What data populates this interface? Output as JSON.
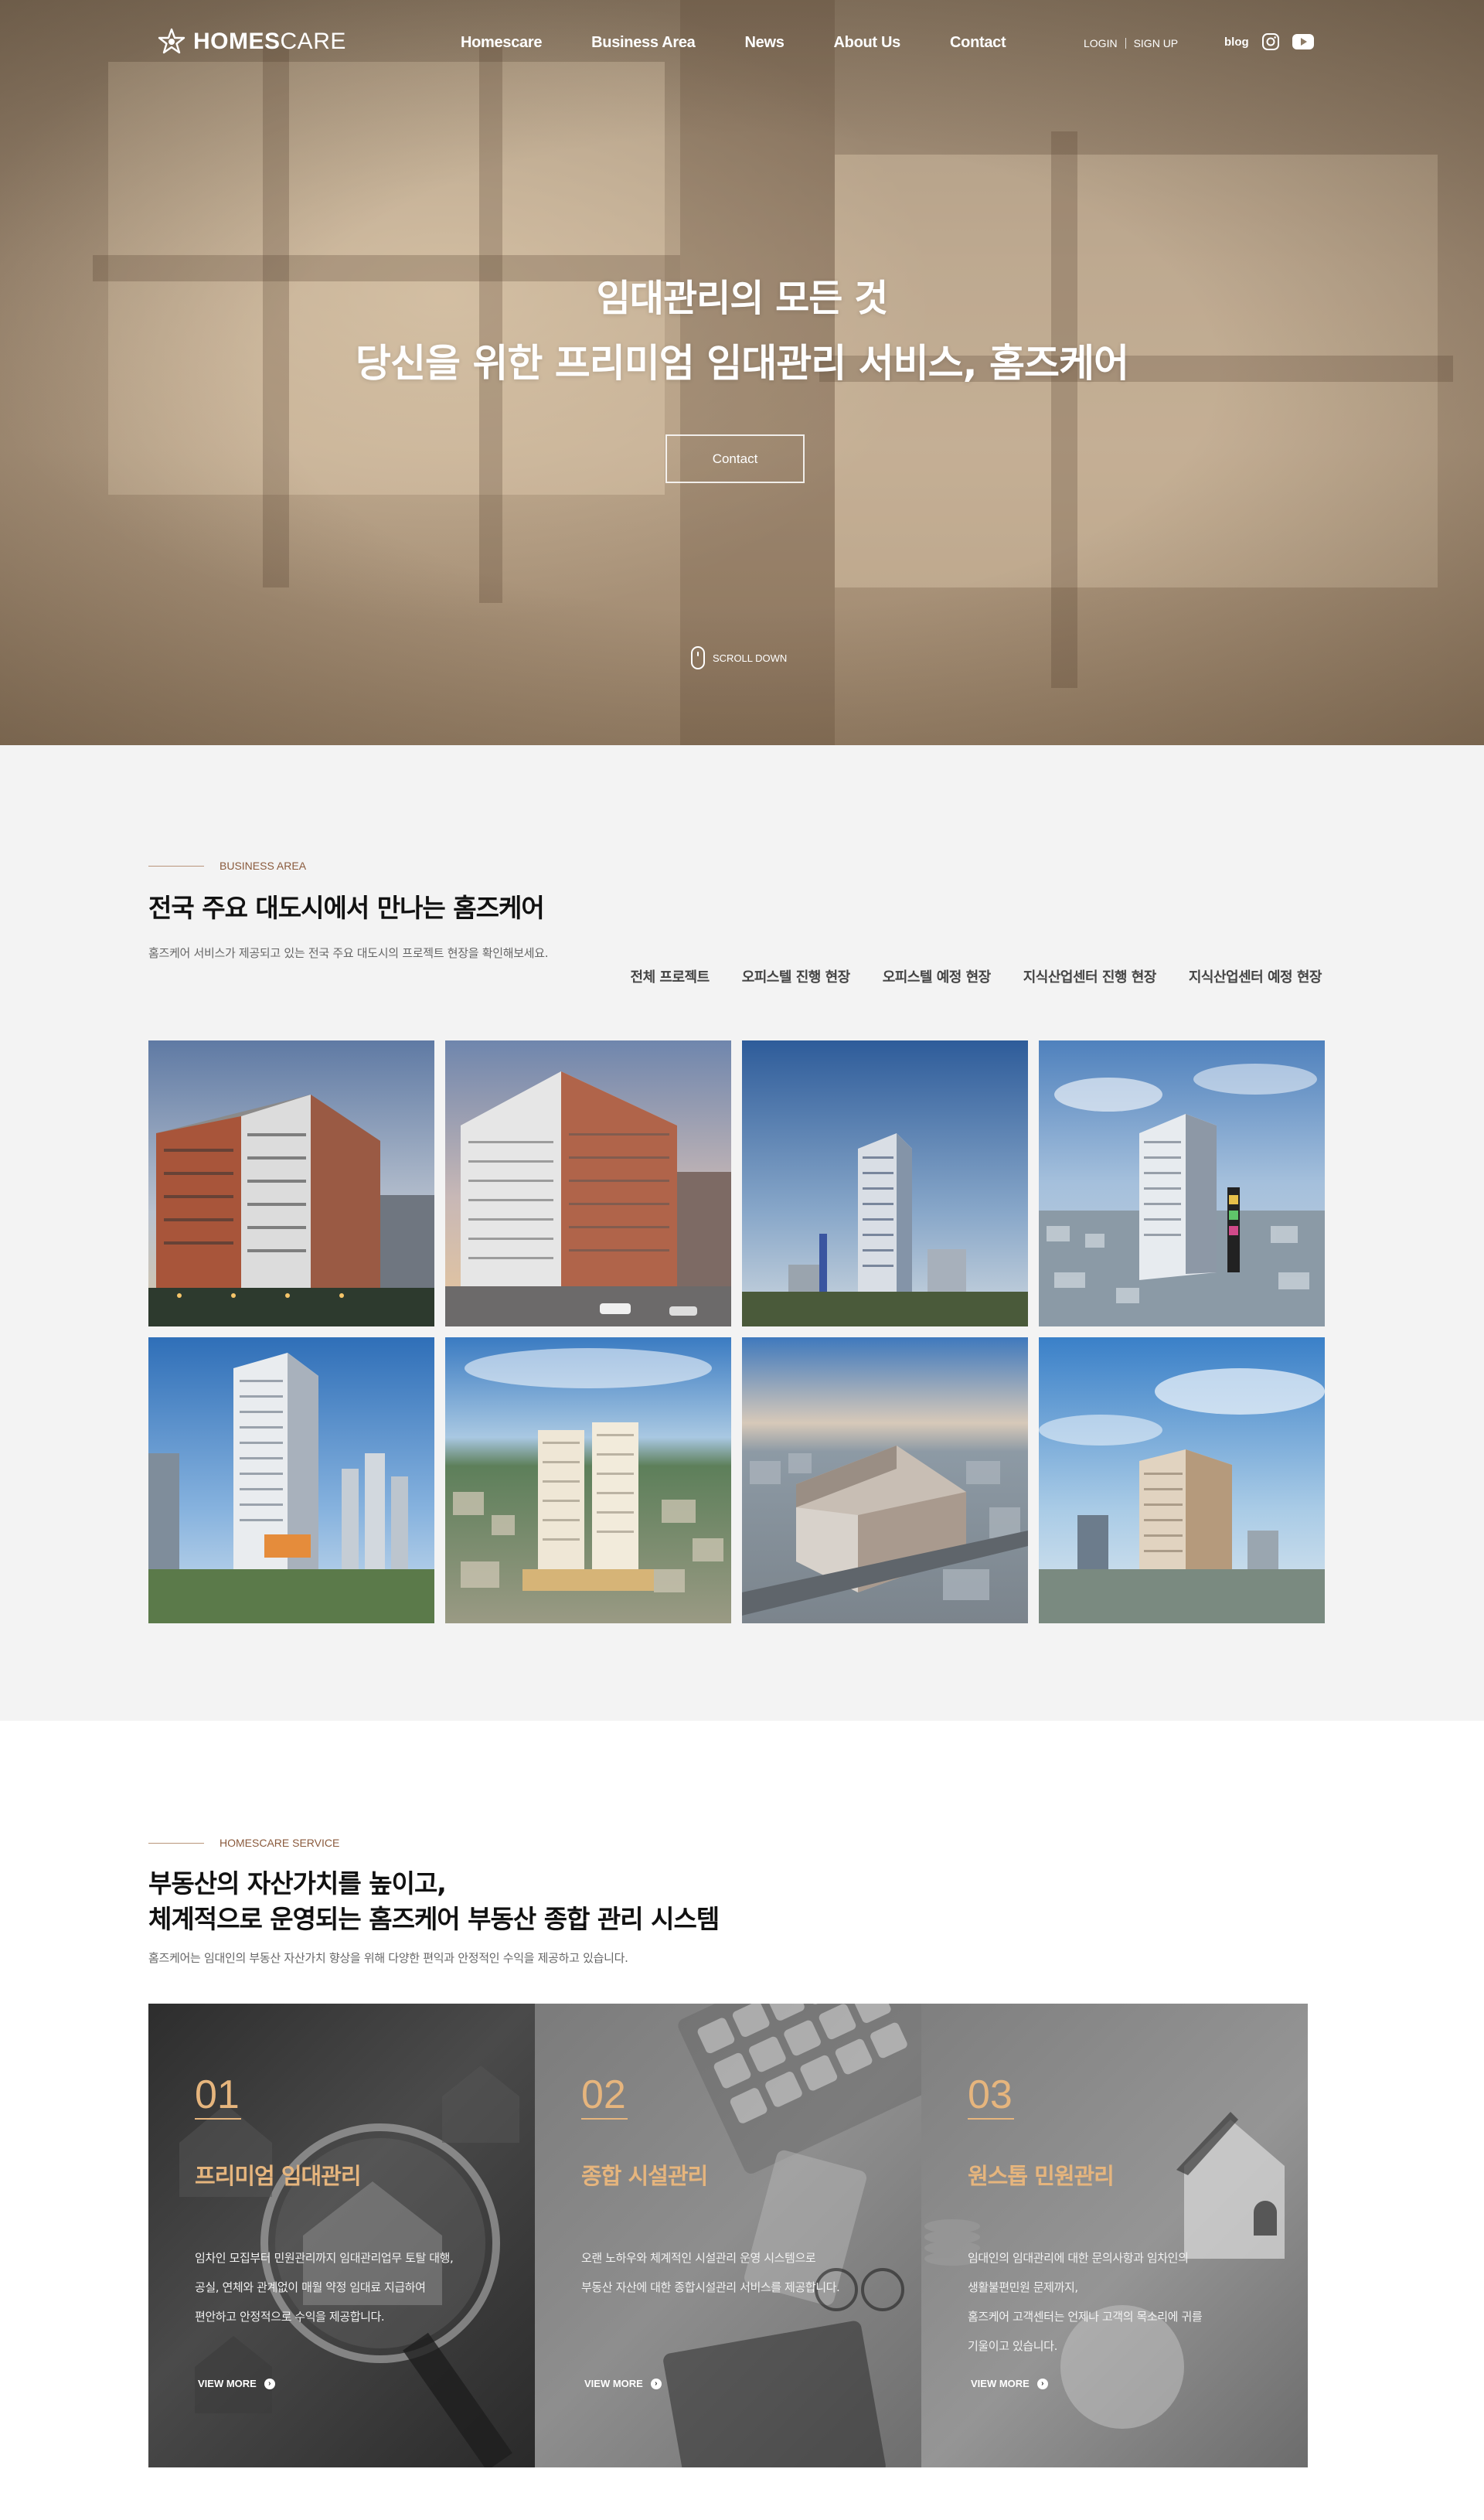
{
  "header": {
    "logo": {
      "bold": "HOMES",
      "light": "CARE"
    },
    "nav": [
      "Homescare",
      "Business Area",
      "News",
      "About Us",
      "Contact"
    ],
    "auth": {
      "login": "LOGIN",
      "signup": "SIGN UP"
    },
    "social": {
      "blog": "blog",
      "icons": [
        "instagram-icon",
        "youtube-icon"
      ]
    }
  },
  "hero": {
    "line1": "임대관리의 모든 것",
    "line2": "당신을 위한 프리미엄 임대관리 서비스, 홈즈케어",
    "button": "Contact",
    "scroll": "SCROLL DOWN"
  },
  "business": {
    "eyebrow": "BUSINESS AREA",
    "title": "전국 주요 대도시에서 만나는 홈즈케어",
    "description": "홈즈케어 서비스가 제공되고 있는 전국 주요 대도시의 프로젝트 현장을 확인해보세요.",
    "filters": [
      "전체 프로젝트",
      "오피스텔 진행 현장",
      "오피스텔 예정 현장",
      "지식산업센터 진행 현장",
      "지식산업센터 예정 현장"
    ]
  },
  "service": {
    "eyebrow": "HOMESCARE SERVICE",
    "title_line1": "부동산의 자산가치를 높이고,",
    "title_line2": "체계적으로 운영되는 홈즈케어 부동산 종합 관리 시스템",
    "description": "홈즈케어는 임대인의 부동산 자산가치 향상을 위해 다양한 편익과 안정적인 수익을 제공하고 있습니다.",
    "cards": [
      {
        "num": "01",
        "title": "프리미엄 임대관리",
        "lines": [
          "임차인 모집부터 민원관리까지 임대관리업무 토탈 대행,",
          "공실, 연체와 관계없이 매월 약정 임대료 지급하여",
          "편안하고 안정적으로 수익을 제공합니다."
        ],
        "more": "VIEW MORE"
      },
      {
        "num": "02",
        "title": "종합 시설관리",
        "lines": [
          "오랜 노하우와 체계적인 시설관리 운영 시스템으로",
          "부동산 자산에 대한 종합시설관리 서비스를 제공합니다."
        ],
        "more": "VIEW MORE"
      },
      {
        "num": "03",
        "title": "원스톱 민원관리",
        "lines": [
          "임대인의 임대관리에 대한 문의사항과 임차인의",
          "생활불편민원 문제까지,",
          "홈즈케어 고객센터는 언제나 고객의 목소리에 귀를",
          "기울이고 있습니다."
        ],
        "more": "VIEW MORE"
      }
    ]
  },
  "colors": {
    "accent": "#e6b57d",
    "eyebrow": "#8a5a3c",
    "section_bg": "#f3f3f3"
  }
}
